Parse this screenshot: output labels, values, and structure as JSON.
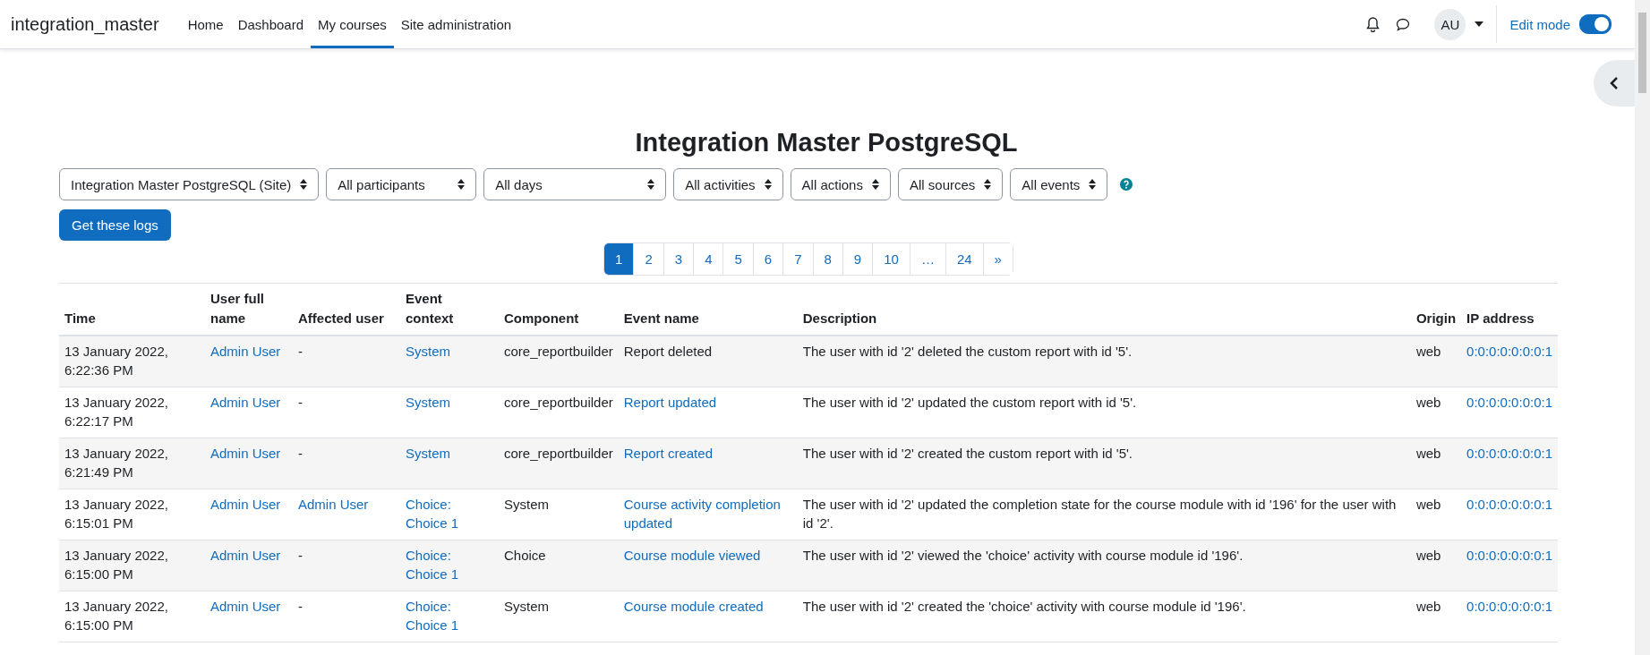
{
  "navbar": {
    "site_name": "integration_master",
    "items": [
      {
        "label": "Home",
        "selected": false
      },
      {
        "label": "Dashboard",
        "selected": false
      },
      {
        "label": "My courses",
        "selected": true
      },
      {
        "label": "Site administration",
        "selected": false
      }
    ],
    "avatar": "AU",
    "edit_mode": {
      "label": "Edit mode",
      "on": true
    }
  },
  "page_title": "Integration Master PostgreSQL",
  "filters": [
    "Integration Master PostgreSQL (Site)",
    "All participants",
    "All days",
    "All activities",
    "All actions",
    "All sources",
    "All events"
  ],
  "submit_button": "Get these logs",
  "pagination": [
    {
      "label": "1",
      "selected": true
    },
    {
      "label": "2",
      "selected": false
    },
    {
      "label": "3",
      "selected": false
    },
    {
      "label": "4",
      "selected": false
    },
    {
      "label": "5",
      "selected": false
    },
    {
      "label": "6",
      "selected": false
    },
    {
      "label": "7",
      "selected": false
    },
    {
      "label": "8",
      "selected": false
    },
    {
      "label": "9",
      "selected": false
    },
    {
      "label": "10",
      "selected": false
    },
    {
      "label": "…",
      "selected": false
    },
    {
      "label": "24",
      "selected": false
    },
    {
      "label": "»",
      "selected": false
    }
  ],
  "table": {
    "columns": [
      "Time",
      "User full name",
      "Affected user",
      "Event context",
      "Component",
      "Event name",
      "Description",
      "Origin",
      "IP address"
    ],
    "rows": [
      [
        {
          "text": "13 January 2022, 6:22:36 PM",
          "link": false
        },
        {
          "text": "Admin User",
          "link": true
        },
        {
          "text": "-",
          "link": false
        },
        {
          "text": "System",
          "link": true
        },
        {
          "text": "core_reportbuilder",
          "link": false
        },
        {
          "text": "Report deleted",
          "link": false
        },
        {
          "text": "The user with id '2' deleted the custom report with id '5'.",
          "link": false
        },
        {
          "text": "web",
          "link": false
        },
        {
          "text": "0:0:0:0:0:0:0:1",
          "link": true
        }
      ],
      [
        {
          "text": "13 January 2022, 6:22:17 PM",
          "link": false
        },
        {
          "text": "Admin User",
          "link": true
        },
        {
          "text": "-",
          "link": false
        },
        {
          "text": "System",
          "link": true
        },
        {
          "text": "core_reportbuilder",
          "link": false
        },
        {
          "text": "Report updated",
          "link": true
        },
        {
          "text": "The user with id '2' updated the custom report with id '5'.",
          "link": false
        },
        {
          "text": "web",
          "link": false
        },
        {
          "text": "0:0:0:0:0:0:0:1",
          "link": true
        }
      ],
      [
        {
          "text": "13 January 2022, 6:21:49 PM",
          "link": false
        },
        {
          "text": "Admin User",
          "link": true
        },
        {
          "text": "-",
          "link": false
        },
        {
          "text": "System",
          "link": true
        },
        {
          "text": "core_reportbuilder",
          "link": false
        },
        {
          "text": "Report created",
          "link": true
        },
        {
          "text": "The user with id '2' created the custom report with id '5'.",
          "link": false
        },
        {
          "text": "web",
          "link": false
        },
        {
          "text": "0:0:0:0:0:0:0:1",
          "link": true
        }
      ],
      [
        {
          "text": "13 January 2022, 6:15:01 PM",
          "link": false
        },
        {
          "text": "Admin User",
          "link": true
        },
        {
          "text": "Admin User",
          "link": true
        },
        {
          "text": "Choice: Choice 1",
          "link": true
        },
        {
          "text": "System",
          "link": false
        },
        {
          "text": "Course activity completion updated",
          "link": true
        },
        {
          "text": "The user with id '2' updated the completion state for the course module with id '196' for the user with id '2'.",
          "link": false
        },
        {
          "text": "web",
          "link": false
        },
        {
          "text": "0:0:0:0:0:0:0:1",
          "link": true
        }
      ],
      [
        {
          "text": "13 January 2022, 6:15:00 PM",
          "link": false
        },
        {
          "text": "Admin User",
          "link": true
        },
        {
          "text": "-",
          "link": false
        },
        {
          "text": "Choice: Choice 1",
          "link": true
        },
        {
          "text": "Choice",
          "link": false
        },
        {
          "text": "Course module viewed",
          "link": true
        },
        {
          "text": "The user with id '2' viewed the 'choice' activity with course module id '196'.",
          "link": false
        },
        {
          "text": "web",
          "link": false
        },
        {
          "text": "0:0:0:0:0:0:0:1",
          "link": true
        }
      ],
      [
        {
          "text": "13 January 2022, 6:15:00 PM",
          "link": false
        },
        {
          "text": "Admin User",
          "link": true
        },
        {
          "text": "-",
          "link": false
        },
        {
          "text": "Choice: Choice 1",
          "link": true
        },
        {
          "text": "System",
          "link": false
        },
        {
          "text": "Course module created",
          "link": true
        },
        {
          "text": "The user with id '2' created the 'choice' activity with course module id '196'.",
          "link": false
        },
        {
          "text": "web",
          "link": false
        },
        {
          "text": "0:0:0:0:0:0:0:1",
          "link": true
        }
      ]
    ]
  }
}
